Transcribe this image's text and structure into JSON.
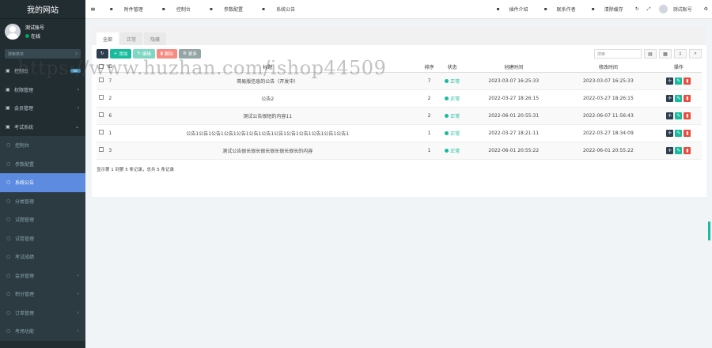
{
  "app": {
    "title": "我的网站",
    "watermark": "https://www.huzhan.com/ishop44509"
  },
  "user": {
    "name": "测试账号",
    "status": "在线"
  },
  "search": {
    "placeholder": "搜索菜单"
  },
  "menu": [
    {
      "label": "控制台",
      "icon": "dashboard-icon",
      "badge": "hot"
    },
    {
      "label": "权限管理",
      "icon": "users-icon",
      "arrow": "‹"
    },
    {
      "label": "会员管理",
      "icon": "user-icon",
      "arrow": "‹"
    },
    {
      "label": "考试系统",
      "icon": "book-icon",
      "arrow": "⌄"
    },
    {
      "label": "控制台",
      "sub": true
    },
    {
      "label": "参数配置",
      "sub": true
    },
    {
      "label": "系统公告",
      "sub": true,
      "active": true
    },
    {
      "label": "分类管理",
      "sub": true
    },
    {
      "label": "试题管理",
      "sub": true
    },
    {
      "label": "试卷管理",
      "sub": true
    },
    {
      "label": "考试成绩",
      "sub": true
    },
    {
      "label": "会员管理",
      "sub": true,
      "arrow": "‹"
    },
    {
      "label": "积分管理",
      "sub": true,
      "arrow": "‹"
    },
    {
      "label": "订单管理",
      "sub": true,
      "arrow": "‹"
    },
    {
      "label": "考场功能",
      "sub": true,
      "arrow": "‹"
    }
  ],
  "topnav": {
    "items": [
      "附件管理",
      "控制台",
      "参数配置",
      "系统公告"
    ],
    "right": [
      "插件介绍",
      "联系作者",
      "清除缓存"
    ],
    "account": "测试账号"
  },
  "tabs": [
    "全部",
    "正常",
    "隐藏"
  ],
  "toolbar": {
    "add": "添加",
    "edit": "编辑",
    "delete": "删除",
    "more": "更多",
    "search_placeholder": "搜索"
  },
  "table": {
    "headers": [
      "ID",
      "标题",
      "排序",
      "状态",
      "创建时间",
      "修改时间",
      "操作"
    ],
    "rows": [
      {
        "id": "7",
        "title": "简易版信息的公告（开发中）",
        "sort": "7",
        "status": "正常",
        "created": "2023-03-07 16:25:33",
        "updated": "2023-03-07 16:25:33"
      },
      {
        "id": "2",
        "title": "公告2",
        "sort": "2",
        "status": "正常",
        "created": "2022-03-27 18:26:15",
        "updated": "2022-03-27 18:26:15"
      },
      {
        "id": "6",
        "title": "测试公告很短的内容11",
        "sort": "2",
        "status": "正常",
        "created": "2022-06-01 20:55:31",
        "updated": "2022-06-07 11:56:43"
      },
      {
        "id": "1",
        "title": "公告1公告1公告1公告1公告1公告1公告1公告1公告1公告1公告1公告1公告1",
        "sort": "1",
        "status": "正常",
        "created": "2022-03-27 18:21:11",
        "updated": "2022-03-27 18:34:09"
      },
      {
        "id": "3",
        "title": "测试公告很长很长很长很长很长很长的内容",
        "sort": "1",
        "status": "正常",
        "created": "2022-06-01 20:55:22",
        "updated": "2022-06-01 20:55:22"
      }
    ]
  },
  "footer": "显示第 1 到第 5 条记录，总共 5 条记录",
  "colors": {
    "sidebar": "#222d32",
    "active": "#5c8be0",
    "green": "#18bc9c",
    "red": "#e74c3c",
    "dark": "#2c3e50"
  }
}
